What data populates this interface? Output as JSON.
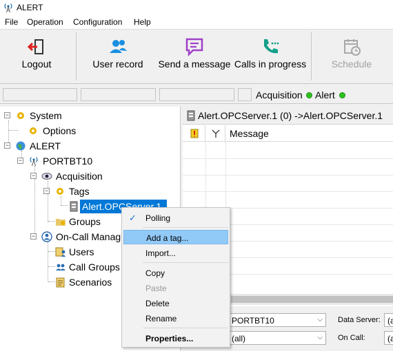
{
  "window": {
    "title": "ALERT",
    "icon": "antenna-icon"
  },
  "menu": {
    "items": [
      "File",
      "Operation",
      "Configuration",
      "Help"
    ]
  },
  "toolbar": {
    "logout": "Logout",
    "user_record": "User record",
    "send_message": "Send a message",
    "calls_in_progress": "Calls in progress",
    "schedule": "Schedule"
  },
  "status": {
    "acquisition_label": "Acquisition",
    "alert_label": "Alert",
    "indicator_color": "#2fc21f"
  },
  "tree": {
    "system": "System",
    "options": "Options",
    "alert": "ALERT",
    "portbt10": "PORTBT10",
    "acquisition": "Acquisition",
    "tags": "Tags",
    "opc_server": "Alert.OPCServer.1",
    "groups": "Groups",
    "oncall": "On-Call Manag",
    "users": "Users",
    "call_groups": "Call Groups",
    "scenarios": "Scenarios"
  },
  "right_panel": {
    "header": "Alert.OPCServer.1 (0) ->Alert.OPCServer.1",
    "columns": {
      "message": "Message"
    },
    "filters": {
      "station_value": "PORTBT10",
      "group_value": "(all)",
      "data_server_label": "Data Server:",
      "data_server_value": "(a",
      "on_call_label": "On Call:",
      "on_call_value": "(a"
    }
  },
  "context_menu": {
    "polling": "Polling",
    "add_tag": "Add a tag...",
    "import": "Import...",
    "copy": "Copy",
    "paste": "Paste",
    "delete": "Delete",
    "rename": "Rename",
    "properties": "Properties..."
  },
  "colors": {
    "selection": "#0078d7",
    "menu_highlight": "#91c9f7"
  }
}
